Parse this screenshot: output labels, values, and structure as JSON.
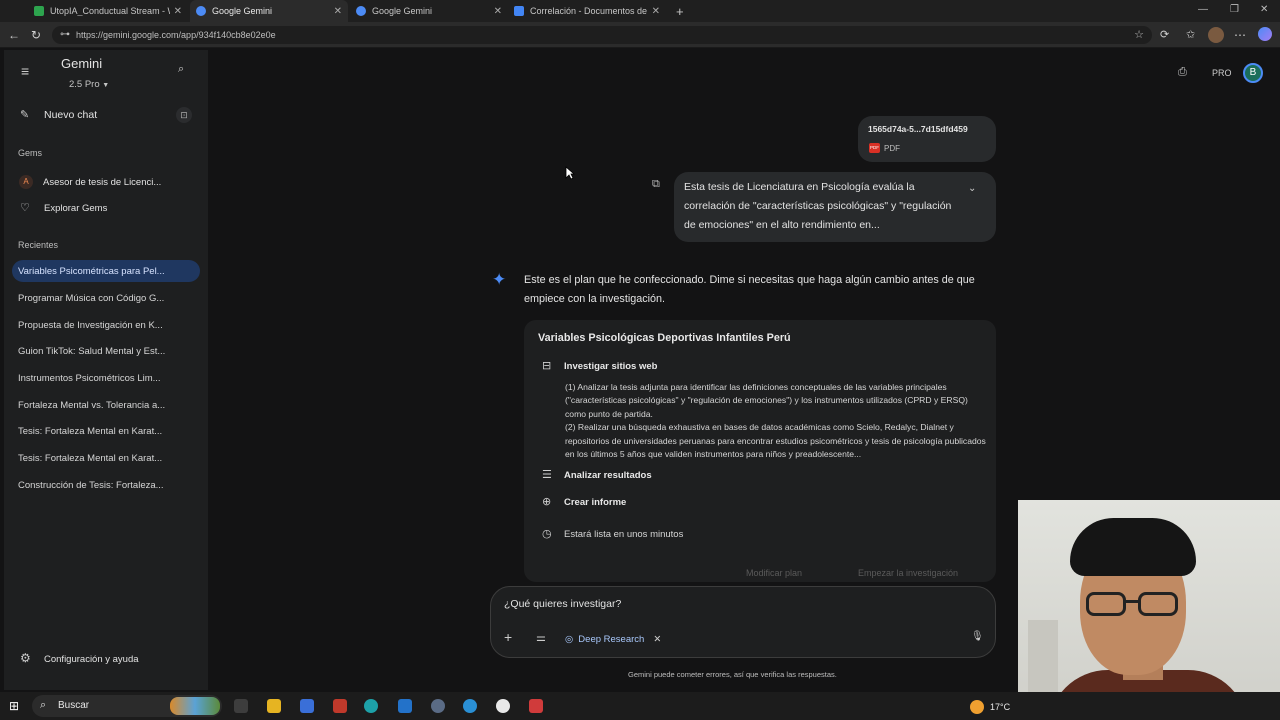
{
  "browser": {
    "tabs": [
      {
        "title": "UtopIA_Conductual Stream - Wat",
        "color": "#2da44e"
      },
      {
        "title": "Google Gemini",
        "color": "#4c8bf5"
      },
      {
        "title": "Google Gemini",
        "color": "#4c8bf5"
      },
      {
        "title": "Correlación - Documentos de Go",
        "color": "#4285f4"
      }
    ],
    "new_tab": "+",
    "url": "https://gemini.google.com/app/934f140cb8e02e0e"
  },
  "sidebar": {
    "app_title": "Gemini",
    "model": "2.5 Pro",
    "new_chat": "Nuevo chat",
    "gems_heading": "Gems",
    "gem_avatar": "A",
    "gem_item": "Asesor de tesis de Licenci...",
    "explore_gems": "Explorar Gems",
    "recent_heading": "Recientes",
    "recents": [
      "Variables Psicométricas para Pel...",
      "Programar Música con Código G...",
      "Propuesta de Investigación en K...",
      "Guion TikTok: Salud Mental y Est...",
      "Instrumentos Psicométricos Lim...",
      "Fortaleza Mental vs. Tolerancia a...",
      "Tesis: Fortaleza Mental en Karat...",
      "Tesis: Fortaleza Mental en Karat...",
      "Construcción de Tesis: Fortaleza..."
    ],
    "settings": "Configuración y ayuda"
  },
  "header": {
    "pro_label": "PRO",
    "avatar": "B"
  },
  "chat": {
    "file_name": "1565d74a-5...7d15dfd459",
    "file_badge": "PDF",
    "file_type": "PDF",
    "user_message": "Esta tesis de Licenciatura en Psicología evalúa la correlación de \"características psicológicas\" y \"regulación de emociones\" en el alto rendimiento en...",
    "assistant_intro": "Este es el plan que he confeccionado. Dime si necesitas que haga algún cambio antes de que empiece con la investigación.",
    "plan": {
      "title": "Variables Psicológicas Deportivas Infantiles Perú",
      "step1": "Investigar sitios web",
      "step1_detail": "(1) Analizar la tesis adjunta para identificar las definiciones conceptuales de las variables principales (\"características psicológicas\" y \"regulación de emociones\") y los instrumentos utilizados (CPRD y ERSQ) como punto de partida.\n(2) Realizar una búsqueda exhaustiva en bases de datos académicas como Scielo, Redalyc, Dialnet y repositorios de universidades peruanas para encontrar estudios psicométricos y tesis de psicología publicados en los últimos 5 años que validen instrumentos para niños y preadolescente...",
      "step2": "Analizar resultados",
      "step3": "Crear informe",
      "eta": "Estará lista en unos minutos",
      "edit_button": "Modificar plan",
      "start_button": "Empezar la investigación"
    },
    "input_placeholder": "¿Qué quieres investigar?",
    "tool_chip": "Deep Research",
    "disclaimer": "Gemini puede cometer errores, así que verifica las respuestas."
  },
  "taskbar": {
    "search": "Buscar",
    "temperature": "17°C"
  }
}
